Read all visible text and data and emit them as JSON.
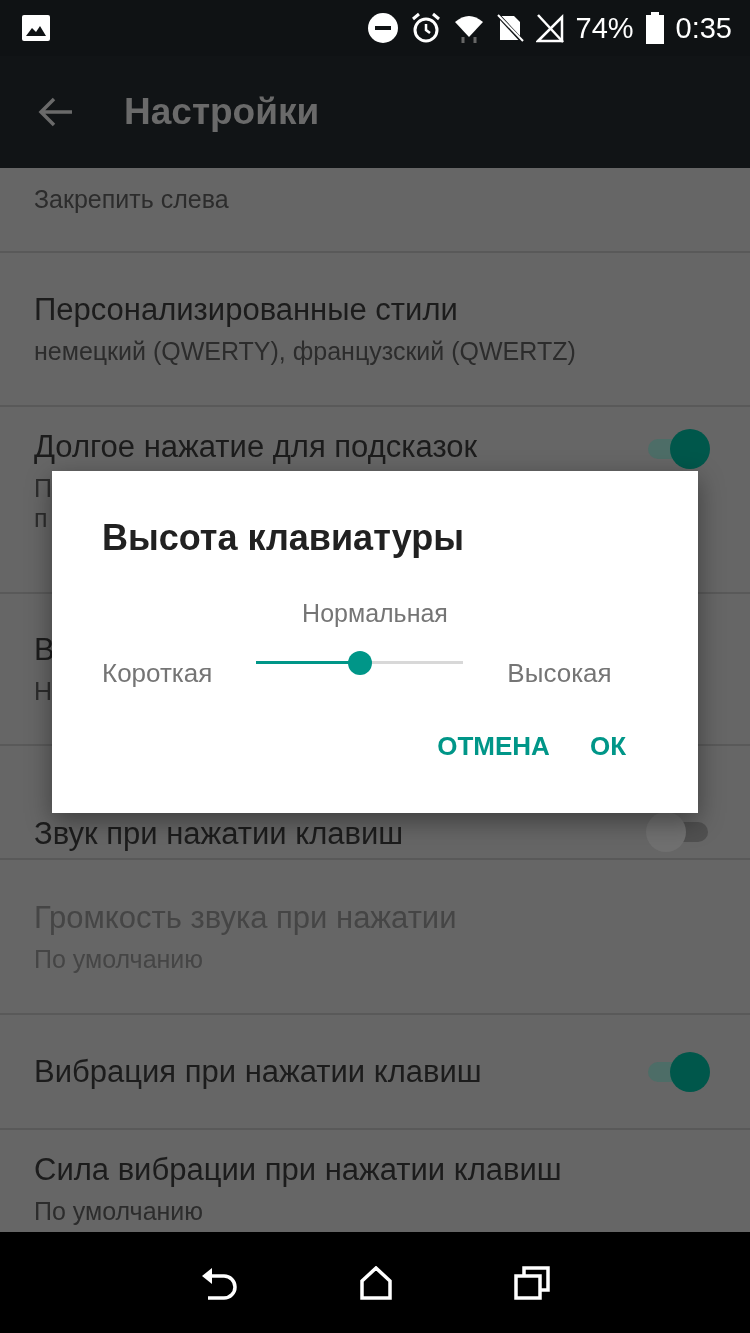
{
  "status_bar": {
    "battery": "74%",
    "time": "0:35"
  },
  "app_bar": {
    "title": "Настройки"
  },
  "settings": [
    {
      "kind": "text",
      "summary": "Закрепить слева",
      "disabled": false
    },
    {
      "kind": "text",
      "title": "Персонализированные стили",
      "summary": "немецкий (QWERTY), французский (QWERTZ)",
      "disabled": false
    },
    {
      "kind": "switch",
      "title": "Долгое нажатие для подсказок",
      "summary": "П\nп",
      "on": true,
      "disabled": false
    },
    {
      "kind": "text",
      "title": "В",
      "summary": "Н",
      "disabled": false
    },
    {
      "kind": "switch",
      "title": "Звук при нажатии клавиш",
      "on": false,
      "disabled": false
    },
    {
      "kind": "text",
      "title": "Громкость звука при нажатии",
      "summary": "По умолчанию",
      "disabled": true
    },
    {
      "kind": "switch",
      "title": "Вибрация при нажатии клавиш",
      "on": true,
      "disabled": false
    },
    {
      "kind": "text",
      "title": "Сила вибрации при нажатии клавиш",
      "summary": "По умолчанию",
      "disabled": false
    }
  ],
  "dialog": {
    "title": "Высота клавиатуры",
    "value_label": "Нормальная",
    "min_label": "Короткая",
    "max_label": "Высокая",
    "level": 0.5,
    "buttons": [
      "ОТМЕНА",
      "ОК"
    ]
  }
}
